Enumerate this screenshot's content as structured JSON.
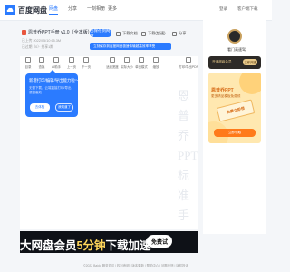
{
  "header": {
    "logo_text": "百度网盘",
    "nav": [
      "网盘",
      "分享",
      "一刻相册",
      "更多"
    ],
    "active_nav": "网盘",
    "right_links": [
      "登录",
      "客户端下载"
    ]
  },
  "file": {
    "title": "恩普乔PPT手册 v1.0（全本版）...",
    "size": "已上传 2022/05/10  65.3M",
    "meta": "已过期（0）· 共享1期"
  },
  "toolbar": {
    "save_button": "已保存到网盘",
    "download_link": "下载文档",
    "download_fast_link": "下载(超速)",
    "share_link": "分享",
    "tooltip": "立刻保存到百度网盘极速传输超高效率享受"
  },
  "viewer": {
    "buttons": [
      {
        "icon": "grid-icon",
        "label": "目录"
      },
      {
        "icon": "search-icon",
        "label": "查找"
      },
      {
        "icon": "ai-icon",
        "label": "AI助手"
      },
      {
        "icon": "arrow-up-icon",
        "label": "上一页"
      },
      {
        "icon": "arrow-down-icon",
        "label": "下一页"
      },
      {
        "icon": "fit-icon",
        "label": "适应宽度"
      },
      {
        "icon": "fullscreen-icon",
        "label": "实际大小"
      },
      {
        "icon": "page-icon",
        "label": "单页模式"
      },
      {
        "icon": "zoom-icon",
        "label": "缩放"
      },
      {
        "icon": "print-icon",
        "label": "打印/导出PDF"
      }
    ],
    "watermark": "恩普乔PPT标准手"
  },
  "popup": {
    "title": "新增打印/编辑/导出能力啦～",
    "body": "无需下载，云端直接打印/导出，便捷高效",
    "primary": "去体验",
    "secondary": "我知道了"
  },
  "sidepanel": {
    "username": "看门高速驾",
    "vip_text": "开通超级会员",
    "vip_button": "立即开通",
    "promo_title": "恩普乔PPT",
    "promo_sub": "更多精品模板免费领",
    "promo_card": "免费立即领",
    "promo_button": "立即领取"
  },
  "banner": {
    "prefix": "大网盘会员",
    "number": "5分钟",
    "suffix": "下载加速",
    "button": "免费试"
  },
  "footer": "©2022 Baidu 服务协议 | 权利声明 | 版本更新 | 帮助中心 | 问题反馈 | 版权投诉"
}
